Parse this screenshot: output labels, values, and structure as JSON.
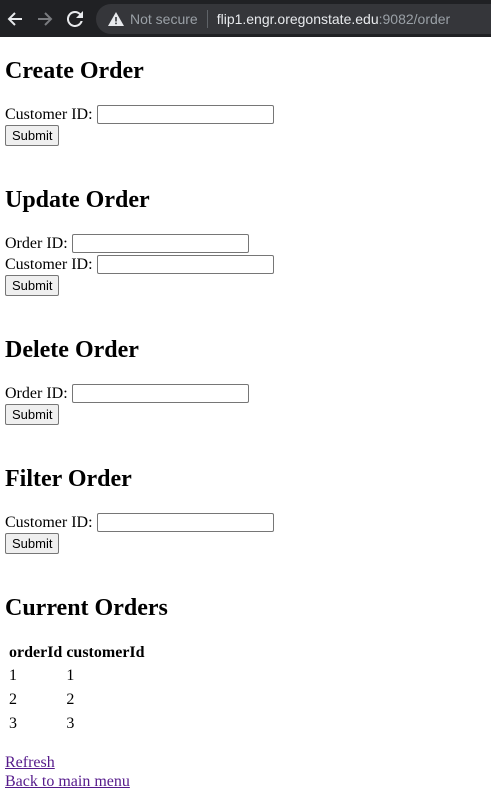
{
  "browser": {
    "security_label": "Not secure",
    "url_host": "flip1.engr.oregonstate.edu",
    "url_rest": ":9082/order"
  },
  "create": {
    "heading": "Create Order",
    "customer_label": "Customer ID:",
    "submit": "Submit"
  },
  "update": {
    "heading": "Update Order",
    "order_label": "Order ID:",
    "customer_label": "Customer ID:",
    "submit": "Submit"
  },
  "delete": {
    "heading": "Delete Order",
    "order_label": "Order ID:",
    "submit": "Submit"
  },
  "filter": {
    "heading": "Filter Order",
    "customer_label": "Customer ID:",
    "submit": "Submit"
  },
  "orders": {
    "heading": "Current Orders",
    "columns": [
      "orderId",
      "customerId"
    ],
    "rows": [
      [
        "1",
        "1"
      ],
      [
        "2",
        "2"
      ],
      [
        "3",
        "3"
      ]
    ]
  },
  "links": {
    "refresh": "Refresh",
    "back": "Back to main menu"
  }
}
